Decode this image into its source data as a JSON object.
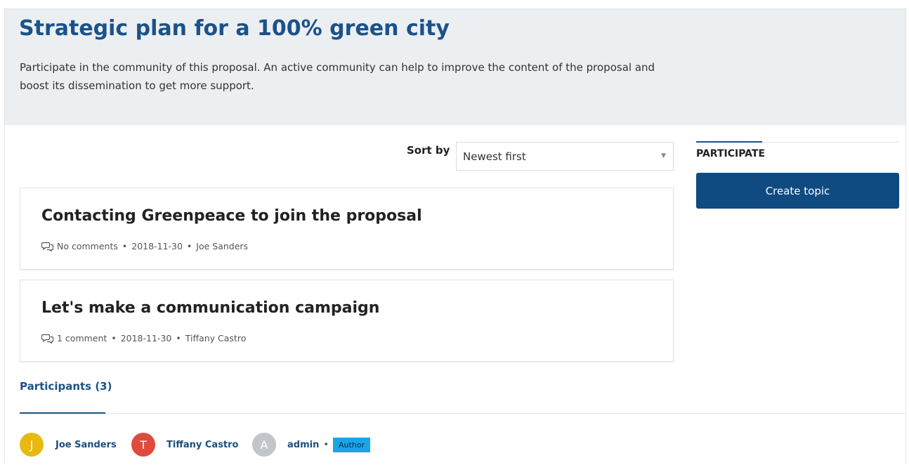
{
  "header": {
    "title": "Strategic plan for a 100% green city",
    "description": "Participate in the community of this proposal. An active community can help to improve the content of the proposal and boost its dissemination to get more support."
  },
  "sort": {
    "label": "Sort by",
    "selected": "Newest first"
  },
  "topics": [
    {
      "title": "Contacting Greenpeace to join the proposal",
      "comments": "No comments",
      "date": "2018-11-30",
      "author": "Joe Sanders"
    },
    {
      "title": "Let's make a communication campaign",
      "comments": "1 comment",
      "date": "2018-11-30",
      "author": "Tiffany Castro"
    }
  ],
  "meta_separator": "•",
  "participants": {
    "title": "Participants (3)",
    "list": [
      {
        "initial": "J",
        "name": "Joe Sanders",
        "color": "#e8b90e"
      },
      {
        "initial": "T",
        "name": "Tiffany Castro",
        "color": "#e04a3c"
      },
      {
        "initial": "A",
        "name": "admin",
        "color": "#c2c5c9",
        "badge": "Author"
      }
    ]
  },
  "sidebar": {
    "heading": "PARTICIPATE",
    "create_label": "Create topic"
  },
  "colors": {
    "brand": "#1b5288",
    "button": "#0f4a80",
    "badge": "#1aa5e6",
    "hero_bg": "#ebeff2"
  }
}
